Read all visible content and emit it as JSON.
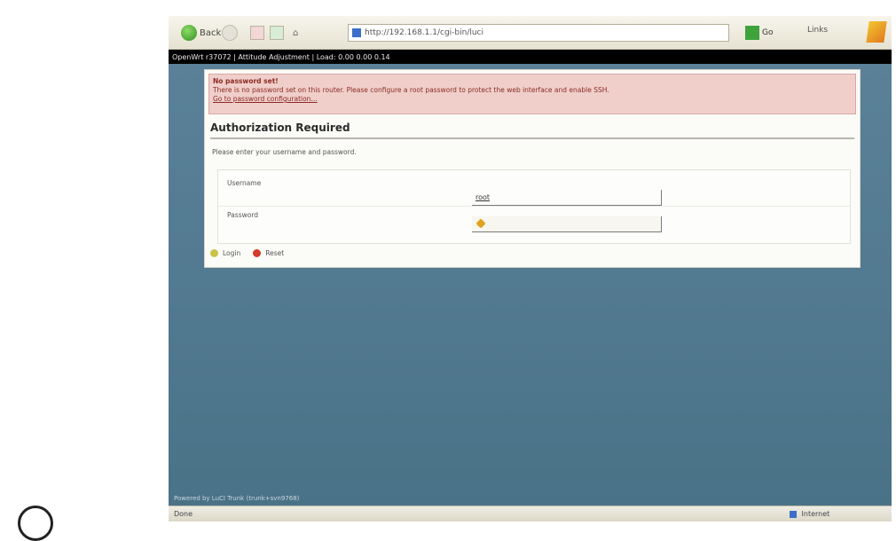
{
  "browser": {
    "back_label": "Back",
    "address": "http://192.168.1.1/cgi-bin/luci",
    "go_label": "Go",
    "links_label": "Links"
  },
  "router": {
    "header": "OpenWrt r37072 | Attitude Adjustment | Load: 0.00 0.00 0.14"
  },
  "alert": {
    "title": "No password set!",
    "text": "There is no password set on this router. Please configure a root password to protect the web interface and enable SSH.",
    "link": "Go to password configuration..."
  },
  "login": {
    "heading": "Authorization Required",
    "description": "Please enter your username and password.",
    "username_label": "Username",
    "username_value": "root",
    "password_label": "Password",
    "login_label": "Login",
    "reset_label": "Reset"
  },
  "footer": "Powered by LuCI Trunk (trunk+svn9768)",
  "status": {
    "left": "Done",
    "right": "Internet"
  }
}
